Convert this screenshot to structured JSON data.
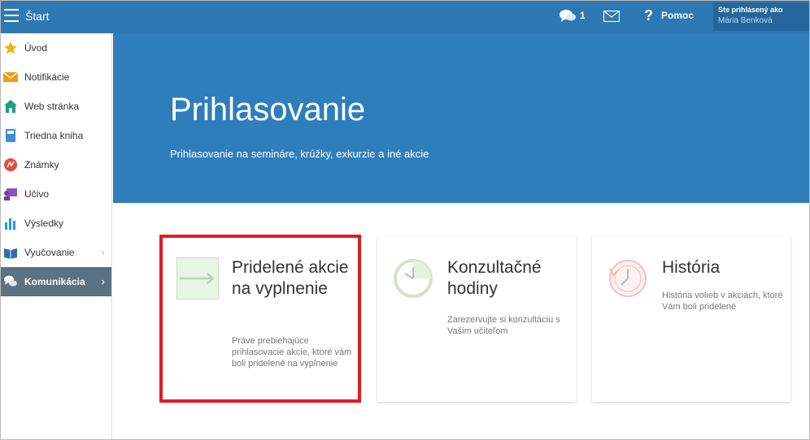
{
  "header": {
    "title": "Štart",
    "chat_count": "1",
    "help_label": "Pomoc",
    "help_icon": "?",
    "user_label": "Ste prihlásený ako",
    "user_name": "Mária Benková"
  },
  "sidebar": {
    "items": [
      {
        "label": "Úvod",
        "icon": "star-icon"
      },
      {
        "label": "Notifikácie",
        "icon": "envelope-icon"
      },
      {
        "label": "Web stránka",
        "icon": "home-icon"
      },
      {
        "label": "Triedna kniha",
        "icon": "book-icon"
      },
      {
        "label": "Známky",
        "icon": "grades-icon"
      },
      {
        "label": "Učivo",
        "icon": "teacher-icon"
      },
      {
        "label": "Výsledky",
        "icon": "bar-chart-icon"
      },
      {
        "label": "Vyučovanie",
        "icon": "open-book-icon",
        "chevron": "›"
      },
      {
        "label": "Komunikácia",
        "icon": "speech-bubbles-icon",
        "chevron": "›",
        "active": true
      }
    ]
  },
  "hero": {
    "title": "Prihlasovanie",
    "subtitle": "Prihlasovanie na semináre, krúžky, exkurzie a iné akcie"
  },
  "cards": [
    {
      "title": "Pridelené akcie na vyplnenie",
      "description": "Práve prebiehajúce prihlasovacie akcie, ktoré vám boli pridelené na vyplnenie",
      "icon": "arrow-right-icon"
    },
    {
      "title": "Konzultačné hodiny",
      "description": "Zarezervujte si konzultáciu s Vašim učiteľom",
      "icon": "clock-icon"
    },
    {
      "title": "História",
      "description": "História volieb v akciách, ktoré Vám boli pridelené",
      "icon": "history-icon"
    }
  ],
  "colors": {
    "topbar": "#2e78b4",
    "hero": "#2f7ebc",
    "active_sidebar": "#5a7282",
    "highlight": "#e31c23"
  }
}
